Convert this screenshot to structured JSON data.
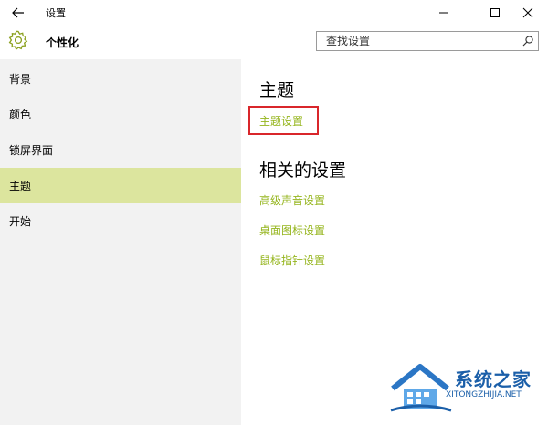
{
  "window": {
    "title": "设置"
  },
  "header": {
    "page_title": "个性化",
    "search_placeholder": "查找设置"
  },
  "sidebar": {
    "items": [
      {
        "label": "背景",
        "active": false
      },
      {
        "label": "颜色",
        "active": false
      },
      {
        "label": "锁屏界面",
        "active": false
      },
      {
        "label": "主题",
        "active": true
      },
      {
        "label": "开始",
        "active": false
      }
    ]
  },
  "main": {
    "section_title": "主题",
    "theme_settings_link": "主题设置",
    "related_title": "相关的设置",
    "related_links": [
      "高级声音设置",
      "桌面图标设置",
      "鼠标指针设置"
    ]
  },
  "watermark": {
    "logo_text": "系统之家",
    "url_text": "XITONGZHIJIA.NET"
  },
  "colors": {
    "accent": "#95b51d",
    "active_nav": "#dce59e",
    "sidebar_bg": "#f2f2f2",
    "highlight_box": "#d9262b"
  }
}
